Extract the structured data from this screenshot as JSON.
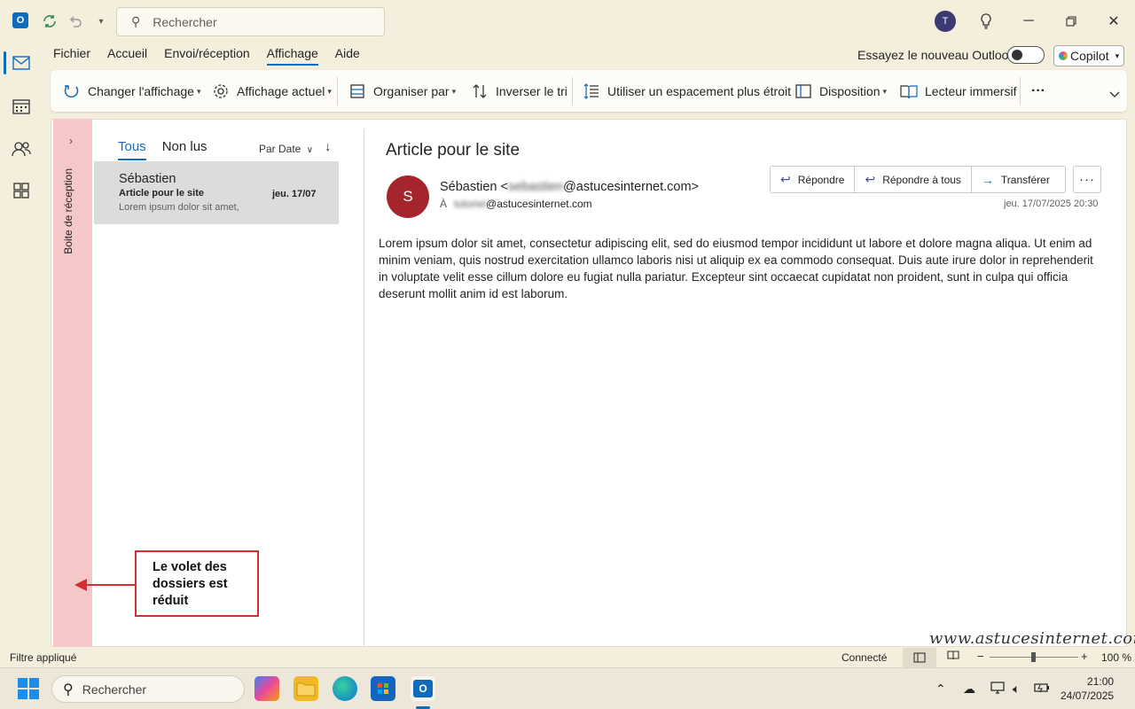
{
  "titlebar": {
    "search_placeholder": "Rechercher",
    "avatar_initial": "T"
  },
  "menu": {
    "tabs": [
      "Fichier",
      "Accueil",
      "Envoi/réception",
      "Affichage",
      "Aide"
    ],
    "active": "Affichage",
    "new_outlook_label": "Essayez le nouveau Outlook",
    "copilot_label": "Copilot"
  },
  "ribbon": {
    "change_view": "Changer l'affichage",
    "current_view": "Affichage actuel",
    "arrange_by": "Organiser par",
    "reverse_sort": "Inverser le tri",
    "compact_spacing": "Utiliser un espacement plus étroit",
    "layout": "Disposition",
    "immersive_reader": "Lecteur immersif",
    "more": "···"
  },
  "folder_pane": {
    "collapsed_label": "Boite de réception"
  },
  "message_list": {
    "tab_all": "Tous",
    "tab_unread": "Non lus",
    "sort_label": "Par Date",
    "items": [
      {
        "sender": "Sébastien",
        "subject": "Article pour le site",
        "date": "jeu. 17/07",
        "preview": "Lorem ipsum dolor sit amet,"
      }
    ]
  },
  "reading_pane": {
    "subject": "Article pour le site",
    "avatar_initial": "S",
    "from_name": "Sébastien <",
    "from_hidden": "sebastien",
    "from_domain": "@astucesinternet.com>",
    "to_label": "À",
    "to_hidden": "tutoriel",
    "to_domain": "@astucesinternet.com",
    "date": "jeu. 17/07/2025 20:30",
    "reply": "Répondre",
    "reply_all": "Répondre à tous",
    "forward": "Transférer",
    "body": "Lorem ipsum dolor sit amet, consectetur adipiscing elit, sed do eiusmod tempor incididunt ut labore et dolore magna aliqua. Ut enim ad minim veniam, quis nostrud exercitation ullamco laboris nisi ut aliquip ex ea commodo consequat. Duis aute irure dolor in reprehenderit in voluptate velit esse cillum dolore eu fugiat nulla pariatur. Excepteur sint occaecat cupidatat non proident, sunt in culpa qui officia deserunt mollit anim id est laborum."
  },
  "callout": {
    "line1": "Le volet des",
    "line2": "dossiers est",
    "line3": "réduit"
  },
  "watermark": "www.astucesinternet.com",
  "statusbar": {
    "filter": "Filtre appliqué",
    "connection": "Connecté",
    "zoom": "100 %"
  },
  "taskbar": {
    "search_placeholder": "Rechercher",
    "time": "21:00",
    "date": "24/07/2025"
  },
  "colors": {
    "accent": "#0f6cbd",
    "folder_pane": "#f5c7c9",
    "avatar_sender": "#a4262c",
    "callout_border": "#d32f2f"
  }
}
